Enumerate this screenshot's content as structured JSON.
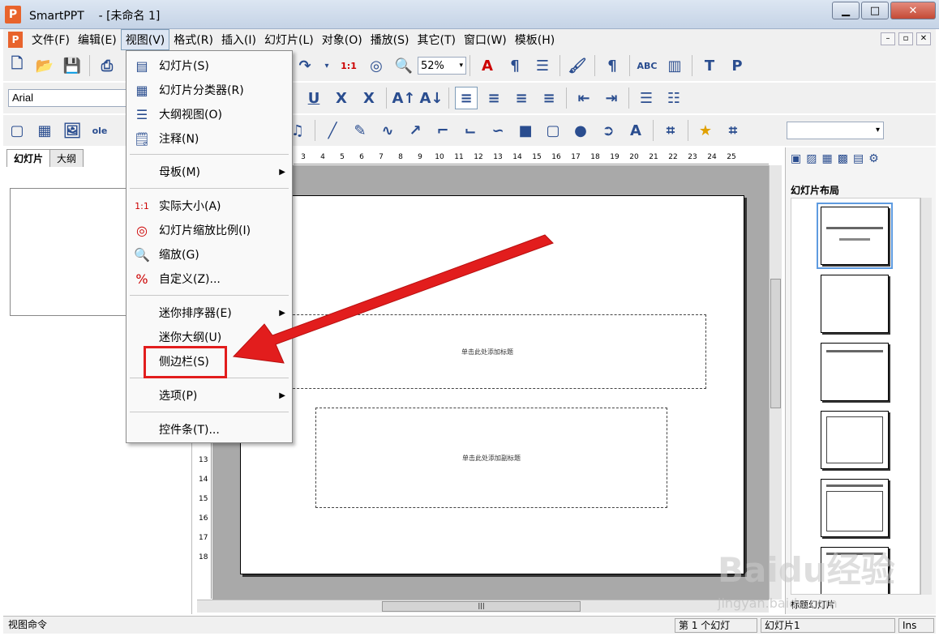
{
  "window": {
    "app_icon": "P",
    "title": "SmartPPT    - [未命名 1]",
    "minimize": "▁",
    "maximize": "□",
    "close": "✕"
  },
  "menubar": {
    "items": [
      "文件(F)",
      "编辑(E)",
      "视图(V)",
      "格式(R)",
      "插入(I)",
      "幻灯片(L)",
      "对象(O)",
      "播放(S)",
      "其它(T)",
      "窗口(W)",
      "模板(H)"
    ],
    "mdi": [
      "–",
      "▫",
      "✕"
    ]
  },
  "toolbar1": {
    "zoom_value": "52%"
  },
  "toolbar2": {
    "font_name": "Arial"
  },
  "left_panel": {
    "tabs": [
      "幻灯片",
      "大纲"
    ]
  },
  "ruler": {
    "h_marks": [
      "3",
      "4",
      "5",
      "6",
      "7",
      "8",
      "9",
      "10",
      "11",
      "12",
      "13",
      "14",
      "15",
      "16",
      "17",
      "18",
      "19",
      "20",
      "21",
      "22",
      "23",
      "24",
      "25"
    ],
    "v_marks": [
      "13",
      "14",
      "15",
      "16",
      "17",
      "18"
    ]
  },
  "slide": {
    "title_placeholder": "单击此处添加标题",
    "subtitle_placeholder": "单击此处添加副标题"
  },
  "right_panel": {
    "title": "幻灯片布局",
    "bottom_label": "标题幻灯片"
  },
  "view_menu": {
    "items": [
      {
        "label": "幻灯片(S)",
        "icon": "slide-icon"
      },
      {
        "label": "幻灯片分类器(R)",
        "icon": "sorter-icon"
      },
      {
        "label": "大纲视图(O)",
        "icon": "outline-icon"
      },
      {
        "label": "注释(N)",
        "icon": "notes-icon"
      },
      {
        "label": "母板(M)"
      },
      {
        "label": "实际大小(A)",
        "icon": "actual-size-icon",
        "icon_text": "1:1"
      },
      {
        "label": "幻灯片缩放比例(I)",
        "icon": "zoom-ratio-icon"
      },
      {
        "label": "缩放(G)",
        "icon": "magnifier-icon"
      },
      {
        "label": "自定义(Z)...",
        "icon": "percent-icon",
        "icon_text": "%"
      },
      {
        "label": "迷你排序器(E)"
      },
      {
        "label": "迷你大纲(U)"
      },
      {
        "label": "侧边栏(S)"
      },
      {
        "label": "选项(P)"
      },
      {
        "label": "控件条(T)..."
      }
    ]
  },
  "statusbar": {
    "command": "视图命令",
    "slide_count": "第 1 个幻灯",
    "slide_name": "幻灯片1",
    "mode": "Ins"
  },
  "watermark": {
    "text": "Baidu经验",
    "url": "jingyan.baidu.com"
  },
  "colors": {
    "annotation_red": "#e21d1d",
    "accent_blue": "#2a4d8f"
  }
}
